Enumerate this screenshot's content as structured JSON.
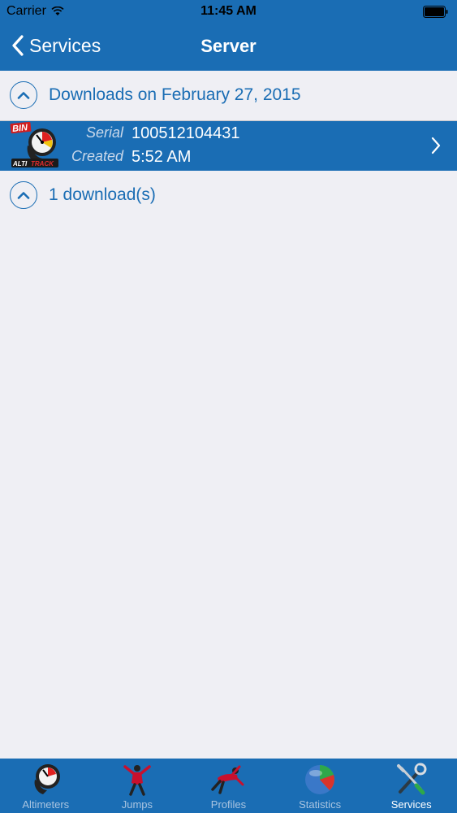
{
  "status_bar": {
    "carrier": "Carrier",
    "time": "11:45 AM"
  },
  "nav": {
    "back_label": "Services",
    "title": "Server"
  },
  "sections": [
    {
      "title": "Downloads on February 27, 2015"
    },
    {
      "title": "1 download(s)"
    }
  ],
  "row": {
    "logo_text": "BIN",
    "brand_text": "ALTITRACK",
    "serial_label": "Serial",
    "serial_value": "100512104431",
    "created_label": "Created",
    "created_value": "5:52 AM"
  },
  "tabs": [
    {
      "label": "Altimeters",
      "icon": "altimeter-icon"
    },
    {
      "label": "Jumps",
      "icon": "skydiver-jump-icon"
    },
    {
      "label": "Profiles",
      "icon": "skydiver-profile-icon"
    },
    {
      "label": "Statistics",
      "icon": "pie-chart-icon"
    },
    {
      "label": "Services",
      "icon": "tools-icon",
      "active": true
    }
  ],
  "colors": {
    "accent": "#1a6db4",
    "background": "#efeff4"
  }
}
